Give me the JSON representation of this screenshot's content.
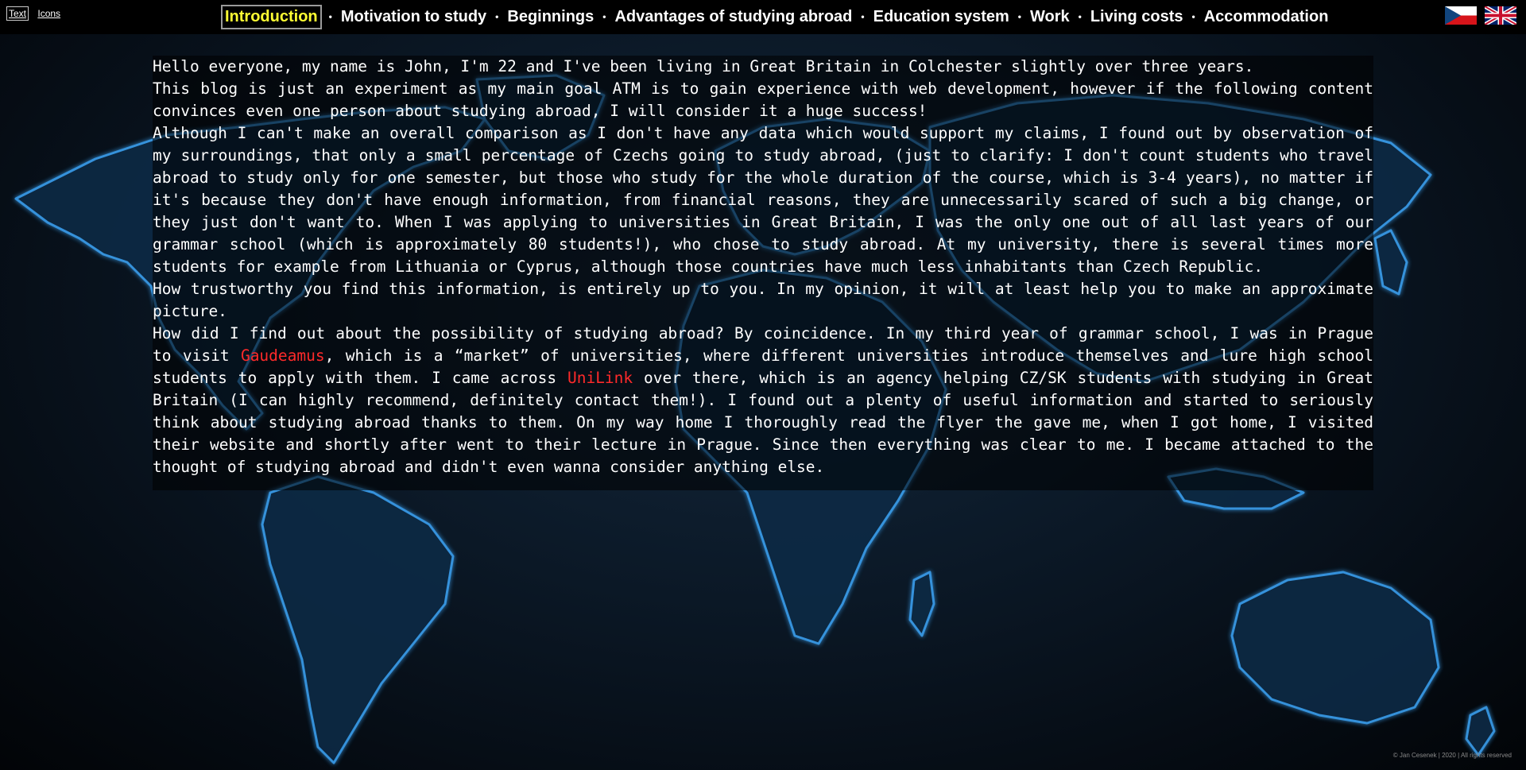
{
  "view_toggle": {
    "text_label": "Text",
    "icons_label": "Icons"
  },
  "nav": {
    "separator": "•",
    "items": [
      {
        "label": "Introduction",
        "active": true
      },
      {
        "label": "Motivation to study",
        "active": false
      },
      {
        "label": "Beginnings",
        "active": false
      },
      {
        "label": "Advantages of studying abroad",
        "active": false
      },
      {
        "label": "Education system",
        "active": false
      },
      {
        "label": "Work",
        "active": false
      },
      {
        "label": "Living costs",
        "active": false
      },
      {
        "label": "Accommodation",
        "active": false
      }
    ]
  },
  "languages": [
    {
      "code": "cz",
      "icon": "czech-flag-icon"
    },
    {
      "code": "en",
      "icon": "uk-flag-icon"
    }
  ],
  "content": {
    "p1": "Hello everyone, my name is John, I'm 22 and I've been living in Great Britain in Colchester slightly over three years.",
    "p2": "This blog is just an experiment as my main goal ATM is to gain experience with web development, however if the following content convinces even one person about studying abroad, I will consider it a huge success!",
    "p3": "Although I can't make an overall comparison as I don't have any data which would support my claims, I found out by observation of my surroundings, that only a small percentage of Czechs going to study abroad, (just to clarify: I don't count students who travel abroad to study only for one semester, but those who study for the whole duration of the course, which is 3-4 years), no matter if it's because they don't have enough information, from financial reasons, they are unnecessarily scared of such a big change, or they just don't want to. When I was applying to universities in Great Britain, I was the only one out of all last years of our grammar school (which is approximately 80 students!), who chose to study abroad. At my university, there is several times more students for example from Lithuania or Cyprus, although those countries have much less inhabitants than Czech Republic.",
    "p4": "How trustworthy you find this information, is entirely up to you. In my opinion, it will at least help you to make an approximate picture.",
    "p5_a": "How did I find out about the possibility of studying abroad? By coincidence. In my third year of grammar school, I was in Prague to visit ",
    "p5_link1": "Gaudeamus",
    "p5_b": ", which is a “market” of universities, where different universities introduce themselves and lure high school students to apply with them. I came across ",
    "p5_link2": "UniLink",
    "p5_c": " over there, which is an agency helping CZ/SK students with studying in Great Britain (I can highly recommend, definitely contact them!). I found out a plenty of useful information and started to seriously think about studying abroad thanks to them. On my way home I thoroughly read the flyer the gave me, when I got home, I visited their website and shortly after went to their lecture in Prague. Since then everything was clear to me. I became attached to the thought of studying abroad and didn't even wanna consider anything else."
  },
  "footer": {
    "text": "© Jan Cesenek | 2020 | All rights reserved"
  },
  "colors": {
    "active_nav": "#ffff33",
    "link": "#ff2a2a",
    "map_glow": "#3aa0f0"
  }
}
